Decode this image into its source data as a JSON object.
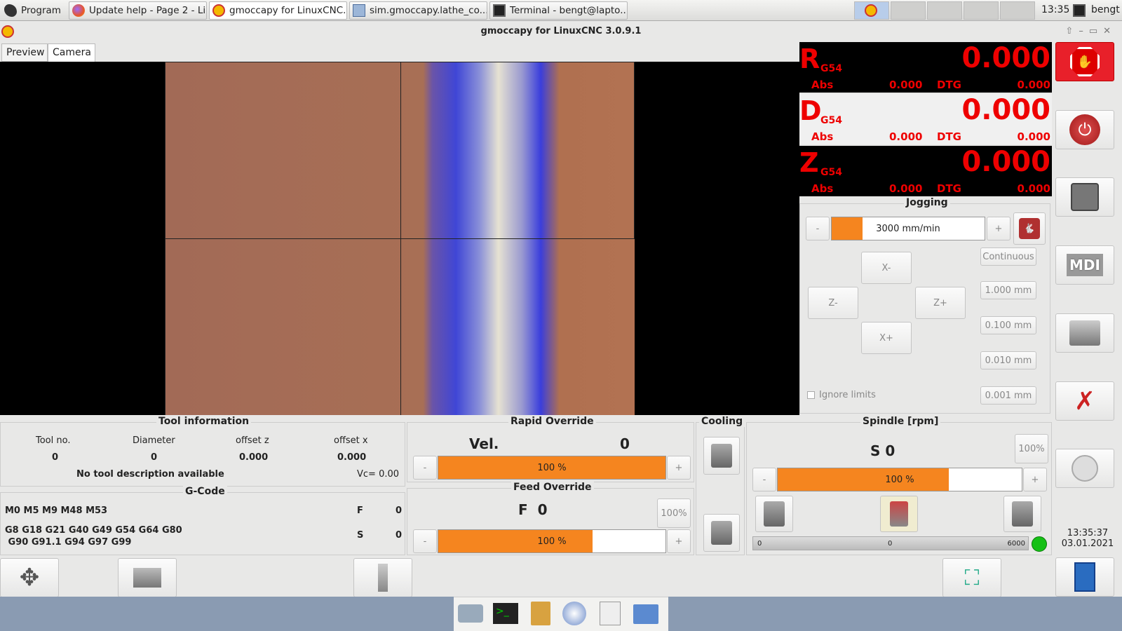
{
  "taskbar": {
    "start_label": "Program",
    "tasks": [
      {
        "label": "Update help - Page 2 - Li...",
        "icon": "firefox-icon"
      },
      {
        "label": "gmoccapy for LinuxCNC...",
        "icon": "linuxcnc-icon"
      },
      {
        "label": "sim.gmoccapy.lathe_co...",
        "icon": "folder-icon"
      },
      {
        "label": "Terminal - bengt@lapto...",
        "icon": "terminal-icon"
      }
    ],
    "clock": "13:35",
    "user": "bengt"
  },
  "window": {
    "title": "gmoccapy for LinuxCNC  3.0.9.1"
  },
  "tabs": [
    "Preview",
    "Camera"
  ],
  "dro": [
    {
      "axis": "R",
      "coord": "G54",
      "value": "0.000",
      "abs_label": "Abs",
      "abs": "0.000",
      "dtg_label": "DTG",
      "dtg": "0.000"
    },
    {
      "axis": "D",
      "coord": "G54",
      "value": "0.000",
      "abs_label": "Abs",
      "abs": "0.000",
      "dtg_label": "DTG",
      "dtg": "0.000"
    },
    {
      "axis": "Z",
      "coord": "G54",
      "value": "0.000",
      "abs_label": "Abs",
      "abs": "0.000",
      "dtg_label": "DTG",
      "dtg": "0.000"
    }
  ],
  "jogging": {
    "title": "Jogging",
    "minus": "-",
    "plus": "+",
    "speed": "3000 mm/min",
    "speed_fill": 0.2,
    "x_minus": "X-",
    "x_plus": "X+",
    "z_minus": "Z-",
    "z_plus": "Z+",
    "increments": [
      "Continuous",
      "1.000 mm",
      "0.100 mm",
      "0.010 mm",
      "0.001 mm"
    ],
    "ignore_limits": "Ignore limits"
  },
  "tool_info": {
    "title": "Tool information",
    "headers": [
      "Tool no.",
      "Diameter",
      "offset z",
      "offset x"
    ],
    "values": [
      "0",
      "0",
      "0.000",
      "0.000"
    ],
    "description": "No tool description available",
    "vc": "Vc= 0.00"
  },
  "gcode": {
    "title": "G-Code",
    "m_codes": "M0 M5 M9 M48 M53",
    "g_codes_1": "G8 G18 G21 G40 G49 G54 G64 G80",
    "g_codes_2": " G90 G91.1 G94 G97 G99",
    "f_label": "F",
    "f_value": "0",
    "s_label": "S",
    "s_value": "0"
  },
  "rapid": {
    "title": "Rapid Override",
    "vel_label": "Vel.",
    "vel_value": "0",
    "minus": "-",
    "plus": "+",
    "percent": "100 %",
    "fill": 1.0
  },
  "feed": {
    "title": "Feed Override",
    "f_label": "F  0",
    "reset": "100%",
    "minus": "-",
    "plus": "+",
    "percent": "100 %",
    "fill": 0.68
  },
  "cooling": {
    "title": "Cooling"
  },
  "spindle": {
    "title": "Spindle [rpm]",
    "s_label": "S 0",
    "reset": "100%",
    "minus": "-",
    "plus": "+",
    "percent": "100 %",
    "fill": 0.7,
    "min": "0",
    "cur": "0",
    "max": "6000"
  },
  "status": {
    "time": "13:35:37",
    "date": "03.01.2021"
  },
  "colors": {
    "accent": "#f5851f",
    "dro_red": "#e00000",
    "estop": "#e8202a"
  }
}
